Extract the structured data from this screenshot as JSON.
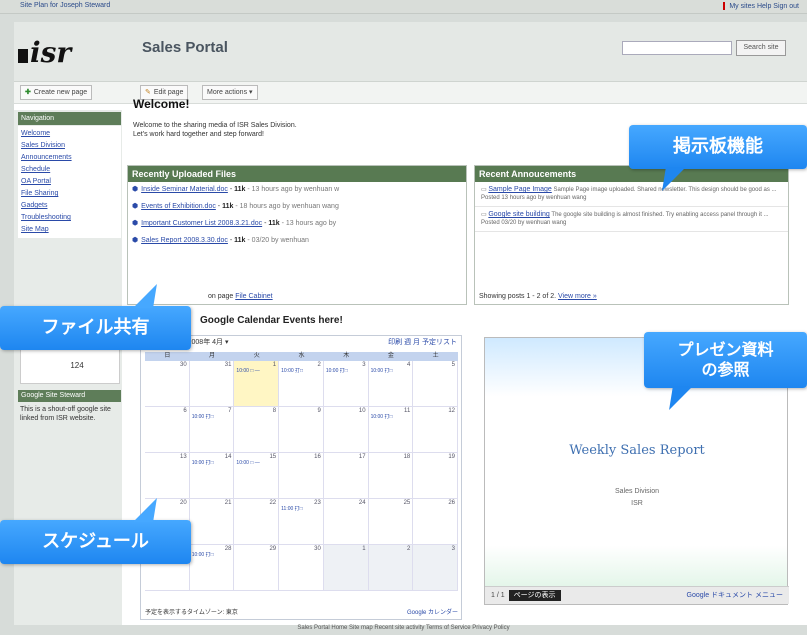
{
  "topbar": {
    "left_text": "Site Plan for Joseph Steward",
    "right_text": "My sites  Help  Sign out"
  },
  "header": {
    "logo": "isr",
    "site_title": "Sales Portal",
    "search_button": "Search site"
  },
  "toolbar": {
    "create_label": "Create new page",
    "edit_label": "Edit page",
    "more_label": "More actions ▾"
  },
  "sidebar": {
    "nav_title": "Navigation",
    "items": [
      "Welcome",
      "Sales Division",
      "Announcements",
      "Schedule",
      "OA Portal",
      "File Sharing",
      "Gadgets",
      "Troubleshooting",
      "Site Map"
    ],
    "box_label": "—",
    "box_value": "124",
    "gadget_title": "Google Site Steward",
    "gadget_text": "This is a shout-off google site linked from ISR website."
  },
  "welcome": {
    "title": "Welcome!",
    "line1": "Welcome to the sharing media of ISR Sales Division.",
    "line2": "Let's work hard together and step forward!"
  },
  "files": {
    "title": "Recently Uploaded Files",
    "rows": [
      {
        "name": "Inside Seminar Material.doc",
        "size": "11k",
        "meta": "- 13 hours ago by wenhuan w"
      },
      {
        "name": "Events of Exhibition.doc",
        "size": "11k",
        "meta": "- 18 hours ago by wenhuan wang"
      },
      {
        "name": "Important Customer List 2008.3.21.doc",
        "size": "11k",
        "meta": "- 13 hours ago by"
      },
      {
        "name": "Sales Report 2008.3.30.doc",
        "size": "11k",
        "meta": "- 03/20 by wenhuan"
      }
    ],
    "footer_prefix": "on page",
    "footer_link": "File Cabinet"
  },
  "announcements": {
    "title": "Recent Annoucements",
    "items": [
      {
        "title": "Sample Page Image",
        "text": "Sample Page image uploaded. Shared newsletter. This design should be good as ...",
        "meta": "Posted 13 hours ago by wenhuan wang"
      },
      {
        "title": "Google site building",
        "text": "The google site building is almost finished. Try enabling access panel through it ...",
        "meta": "Posted 03/20 by wenhuan wang"
      }
    ],
    "footer_text": "Showing posts 1 - 2 of 2.",
    "footer_link": "View more »"
  },
  "calendar": {
    "heading": "Google Calendar Events here!",
    "today_btn": "今日",
    "month": "2008年 4月 ▾",
    "tabs": "印刷  週  月  予定リスト",
    "weekdays": [
      "日",
      "月",
      "火",
      "水",
      "木",
      "金",
      "土"
    ],
    "weeks": [
      [
        {
          "d": "30"
        },
        {
          "d": "31"
        },
        {
          "d": "1",
          "t": true,
          "e": "10:00 □ ―"
        },
        {
          "d": "2",
          "e": "10:00 打□"
        },
        {
          "d": "3",
          "e": "10:00 打□"
        },
        {
          "d": "4",
          "e": "10:00 打□"
        },
        {
          "d": "5"
        }
      ],
      [
        {
          "d": "6"
        },
        {
          "d": "7",
          "e": "10:00 打□"
        },
        {
          "d": "8"
        },
        {
          "d": "9"
        },
        {
          "d": "10"
        },
        {
          "d": "11",
          "e": "10:00 打□"
        },
        {
          "d": "12"
        }
      ],
      [
        {
          "d": "13"
        },
        {
          "d": "14",
          "e": "10:00 打□"
        },
        {
          "d": "15",
          "e": "10:00 □ ―"
        },
        {
          "d": "16"
        },
        {
          "d": "17"
        },
        {
          "d": "18"
        },
        {
          "d": "19"
        }
      ],
      [
        {
          "d": "20"
        },
        {
          "d": "21"
        },
        {
          "d": "22"
        },
        {
          "d": "23",
          "e": "11:00 打□"
        },
        {
          "d": "24"
        },
        {
          "d": "25"
        },
        {
          "d": "26"
        }
      ],
      [
        {
          "d": "27"
        },
        {
          "d": "28",
          "e": "10:00 打□"
        },
        {
          "d": "29"
        },
        {
          "d": "30"
        },
        {
          "d": "1",
          "dim": true
        },
        {
          "d": "2",
          "dim": true
        },
        {
          "d": "3",
          "dim": true
        }
      ]
    ],
    "footer_left": "予定を表示するタイムゾーン: 東京",
    "footer_right": "Google カレンダー"
  },
  "presentation": {
    "title": "Weekly Sales Report",
    "sub1": "Sales Division",
    "sub2": "ISR",
    "page_label": "1 / 1",
    "control": "ページの表示",
    "right": "Google ドキュメント  メニュー"
  },
  "callouts": {
    "bbs": "掲示板機能",
    "file": "ファイル共有",
    "pres_line1": "プレゼン資料",
    "pres_line2": "の参照",
    "schedule": "スケジュール"
  },
  "footer": {
    "text": "Sales Portal  Home  Site map  Recent site activity  Terms of Service  Privacy Policy"
  },
  "colors": {
    "nav_green": "#587a52",
    "callout_blue": "#1e86f0",
    "link_blue": "#2a4aa8"
  }
}
